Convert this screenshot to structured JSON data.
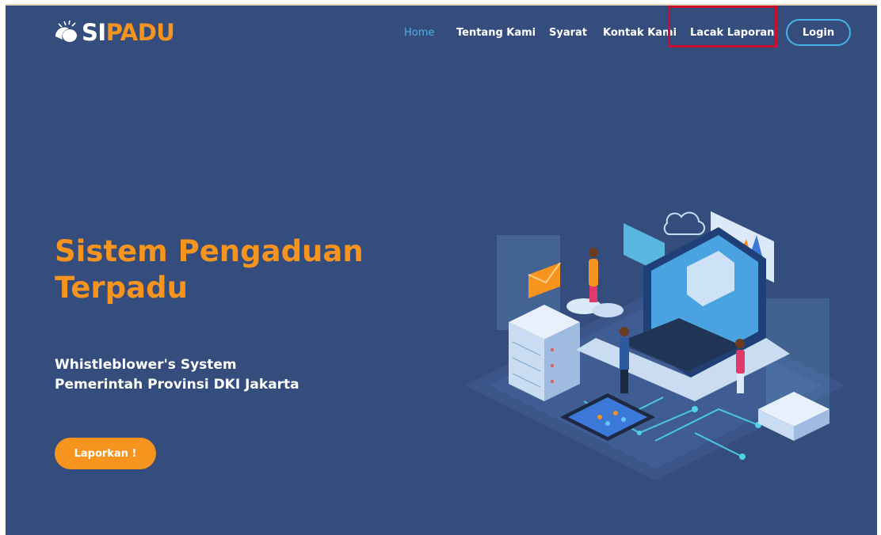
{
  "logo": {
    "prefix": "SI",
    "suffix": "PADU"
  },
  "nav": {
    "items": [
      {
        "label": "Home",
        "active": true
      },
      {
        "label": "Tentang Kami",
        "active": false
      },
      {
        "label": "Syarat",
        "active": false
      },
      {
        "label": "Kontak Kami",
        "active": false
      },
      {
        "label": "Lacak Laporan",
        "active": false
      }
    ],
    "login_label": "Login"
  },
  "hero": {
    "title_line1": "Sistem Pengaduan",
    "title_line2": "Terpadu",
    "subtitle_line1": "Whistleblower's System",
    "subtitle_line2": "Pemerintah Provinsi DKI Jakarta",
    "cta_label": "Laporkan !"
  },
  "colors": {
    "background": "#354d7c",
    "accent_orange": "#f7941d",
    "accent_blue": "#47b2e4",
    "highlight_red": "#c8102e"
  },
  "icons": [
    "logo-icon",
    "cloud-icon",
    "envelope-icon",
    "chart-icon",
    "server-icon",
    "laptop-icon",
    "smartphone-icon"
  ]
}
